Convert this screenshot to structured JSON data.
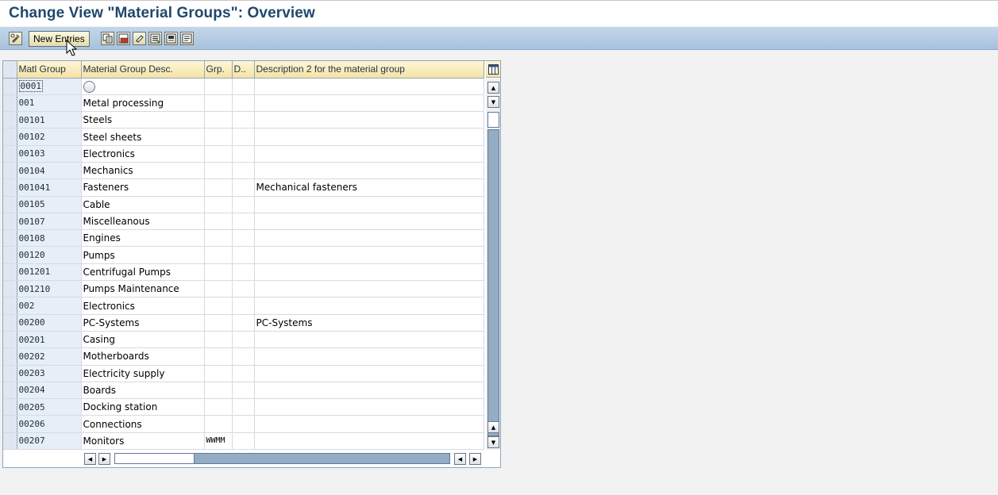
{
  "window": {
    "title": "Change View \"Material Groups\": Overview"
  },
  "toolbar": {
    "new_entries_label": "New Entries"
  },
  "table": {
    "columns": [
      "Matl Group",
      "Material Group Desc.",
      "Grp.",
      "D..",
      "Description 2 for the material group"
    ],
    "rows": [
      {
        "group": "0001",
        "desc": "",
        "grp": "",
        "d": "",
        "desc2": ""
      },
      {
        "group": "001",
        "desc": "Metal processing",
        "grp": "",
        "d": "",
        "desc2": ""
      },
      {
        "group": "00101",
        "desc": "Steels",
        "grp": "",
        "d": "",
        "desc2": ""
      },
      {
        "group": "00102",
        "desc": "Steel sheets",
        "grp": "",
        "d": "",
        "desc2": ""
      },
      {
        "group": "00103",
        "desc": "Electronics",
        "grp": "",
        "d": "",
        "desc2": ""
      },
      {
        "group": "00104",
        "desc": "Mechanics",
        "grp": "",
        "d": "",
        "desc2": ""
      },
      {
        "group": "001041",
        "desc": "Fasteners",
        "grp": "",
        "d": "",
        "desc2": "Mechanical fasteners"
      },
      {
        "group": "00105",
        "desc": "Cable",
        "grp": "",
        "d": "",
        "desc2": ""
      },
      {
        "group": "00107",
        "desc": "Miscelleanous",
        "grp": "",
        "d": "",
        "desc2": ""
      },
      {
        "group": "00108",
        "desc": "Engines",
        "grp": "",
        "d": "",
        "desc2": ""
      },
      {
        "group": "00120",
        "desc": "Pumps",
        "grp": "",
        "d": "",
        "desc2": ""
      },
      {
        "group": "001201",
        "desc": "Centrifugal Pumps",
        "grp": "",
        "d": "",
        "desc2": ""
      },
      {
        "group": "001210",
        "desc": "Pumps Maintenance",
        "grp": "",
        "d": "",
        "desc2": ""
      },
      {
        "group": "002",
        "desc": "Electronics",
        "grp": "",
        "d": "",
        "desc2": ""
      },
      {
        "group": "00200",
        "desc": "PC-Systems",
        "grp": "",
        "d": "",
        "desc2": "PC-Systems"
      },
      {
        "group": "00201",
        "desc": "Casing",
        "grp": "",
        "d": "",
        "desc2": ""
      },
      {
        "group": "00202",
        "desc": "Motherboards",
        "grp": "",
        "d": "",
        "desc2": ""
      },
      {
        "group": "00203",
        "desc": "Electricity supply",
        "grp": "",
        "d": "",
        "desc2": ""
      },
      {
        "group": "00204",
        "desc": "Boards",
        "grp": "",
        "d": "",
        "desc2": ""
      },
      {
        "group": "00205",
        "desc": "Docking station",
        "grp": "",
        "d": "",
        "desc2": ""
      },
      {
        "group": "00206",
        "desc": "Connections",
        "grp": "",
        "d": "",
        "desc2": ""
      },
      {
        "group": "00207",
        "desc": "Monitors",
        "grp": "WWMM",
        "d": "",
        "desc2": ""
      }
    ]
  }
}
